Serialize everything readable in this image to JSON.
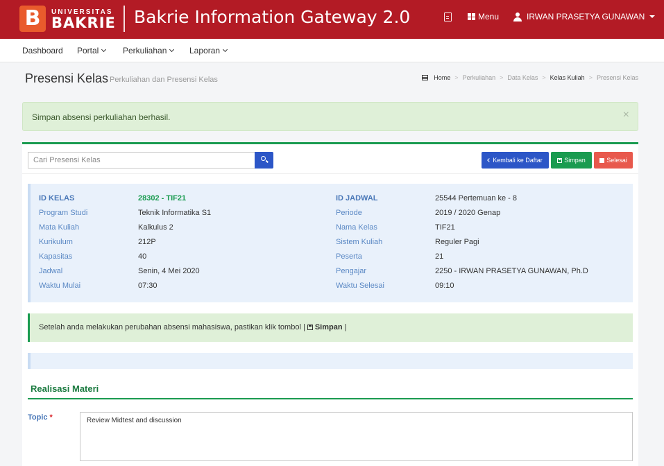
{
  "header": {
    "logo_letter": "B",
    "logo_universitas": "UNIVERSITAS",
    "logo_bakrie": "BAKRIE",
    "app_title": "Bakrie Information Gateway 2.0",
    "menu_label": "Menu",
    "user_name": "IRWAN PRASETYA GUNAWAN"
  },
  "nav": {
    "items": [
      {
        "label": "Dashboard"
      },
      {
        "label": "Portal"
      },
      {
        "label": "Perkuliahan"
      },
      {
        "label": "Laporan"
      }
    ]
  },
  "page": {
    "title": "Presensi Kelas",
    "subtitle": "Perkuliahan dan Presensi Kelas",
    "breadcrumb": [
      "Home",
      "Perkuliahan",
      "Data Kelas",
      "Kelas Kuliah",
      "Presensi Kelas"
    ]
  },
  "alert": {
    "message": "Simpan absensi perkuliahan berhasil.",
    "close": "×"
  },
  "toolbar": {
    "search_placeholder": "Cari Presensi Kelas",
    "back_label": "Kembali ke Daftar",
    "save_label": "Simpan",
    "done_label": "Selesai"
  },
  "info": {
    "left": [
      {
        "label": "ID KELAS",
        "value": "28302 - TIF21"
      },
      {
        "label": "Program Studi",
        "value": "Teknik Informatika S1"
      },
      {
        "label": "Mata Kuliah",
        "value": "Kalkulus 2"
      },
      {
        "label": "Kurikulum",
        "value": "212P"
      },
      {
        "label": "Kapasitas",
        "value": "40"
      },
      {
        "label": "Jadwal",
        "value": "Senin, 4 Mei 2020"
      },
      {
        "label": "Waktu Mulai",
        "value": "07:30"
      }
    ],
    "right": [
      {
        "label": "ID JADWAL",
        "value": "25544 Pertemuan ke - 8"
      },
      {
        "label": "Periode",
        "value": "2019 / 2020 Genap"
      },
      {
        "label": "Nama Kelas",
        "value": "TIF21"
      },
      {
        "label": "Sistem Kuliah",
        "value": "Reguler Pagi"
      },
      {
        "label": "Peserta",
        "value": "21"
      },
      {
        "label": "Pengajar",
        "value": "2250 - IRWAN PRASETYA GUNAWAN, Ph.D"
      },
      {
        "label": "Waktu Selesai",
        "value": "09:10"
      }
    ]
  },
  "notice": {
    "text": "Setelah anda melakukan perubahan absensi mahasiswa, pastikan klik tombol |",
    "button_ref": "Simpan",
    "suffix": "|"
  },
  "materi": {
    "section_title": "Realisasi Materi",
    "topic_label": "Topic",
    "required_mark": "*",
    "topic_value": "Review Midtest and discussion"
  },
  "colors": {
    "header_bg": "#b31b25",
    "primary": "#2c56c7",
    "success": "#1a9b50",
    "danger": "#e8594d"
  }
}
